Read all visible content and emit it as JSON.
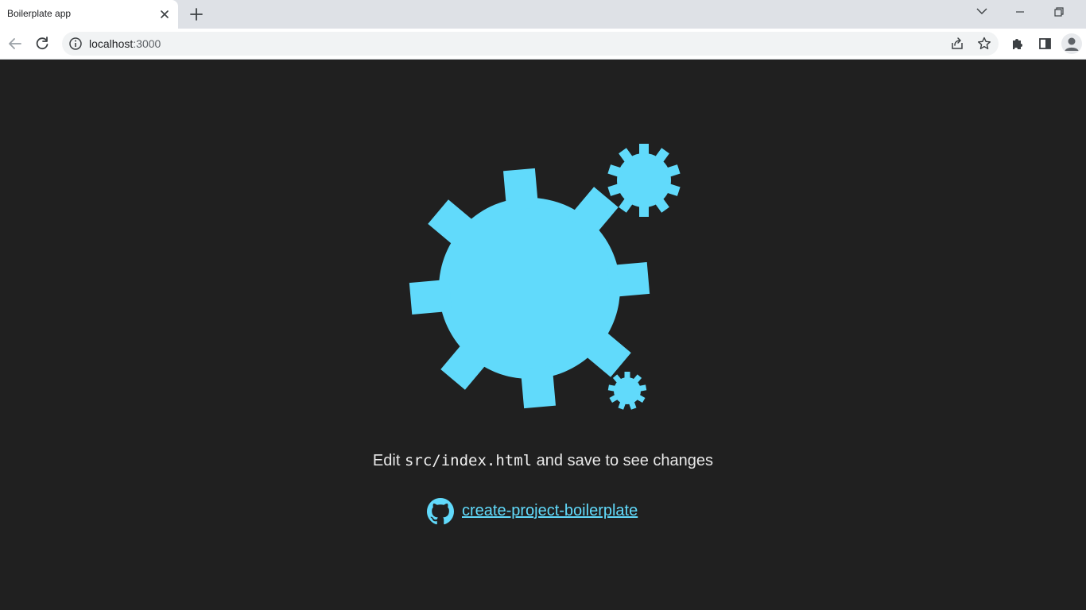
{
  "tab": {
    "title": "Boilerplate app"
  },
  "omnibox": {
    "host": "localhost",
    "port": ":3000"
  },
  "page": {
    "edit_prefix": "Edit ",
    "edit_code": "src/index.html",
    "edit_suffix": " and save to see changes",
    "link_text": "create-project-boilerplate"
  },
  "colors": {
    "accent": "#61dafb",
    "page_background": "#202020",
    "tabstrip": "#dee1e6"
  },
  "icons": {
    "tab_close": "close-icon",
    "new_tab": "plus-icon",
    "tab_search": "chevron-down-icon",
    "minimize": "minimize-icon",
    "restore": "restore-icon",
    "back": "arrow-left-icon",
    "reload": "reload-icon",
    "site_info": "info-icon",
    "share": "share-icon",
    "bookmark": "star-icon",
    "extensions": "puzzle-icon",
    "side_panel": "side-panel-icon",
    "profile": "profile-icon",
    "github": "github-icon",
    "logo": "gears-logo"
  }
}
